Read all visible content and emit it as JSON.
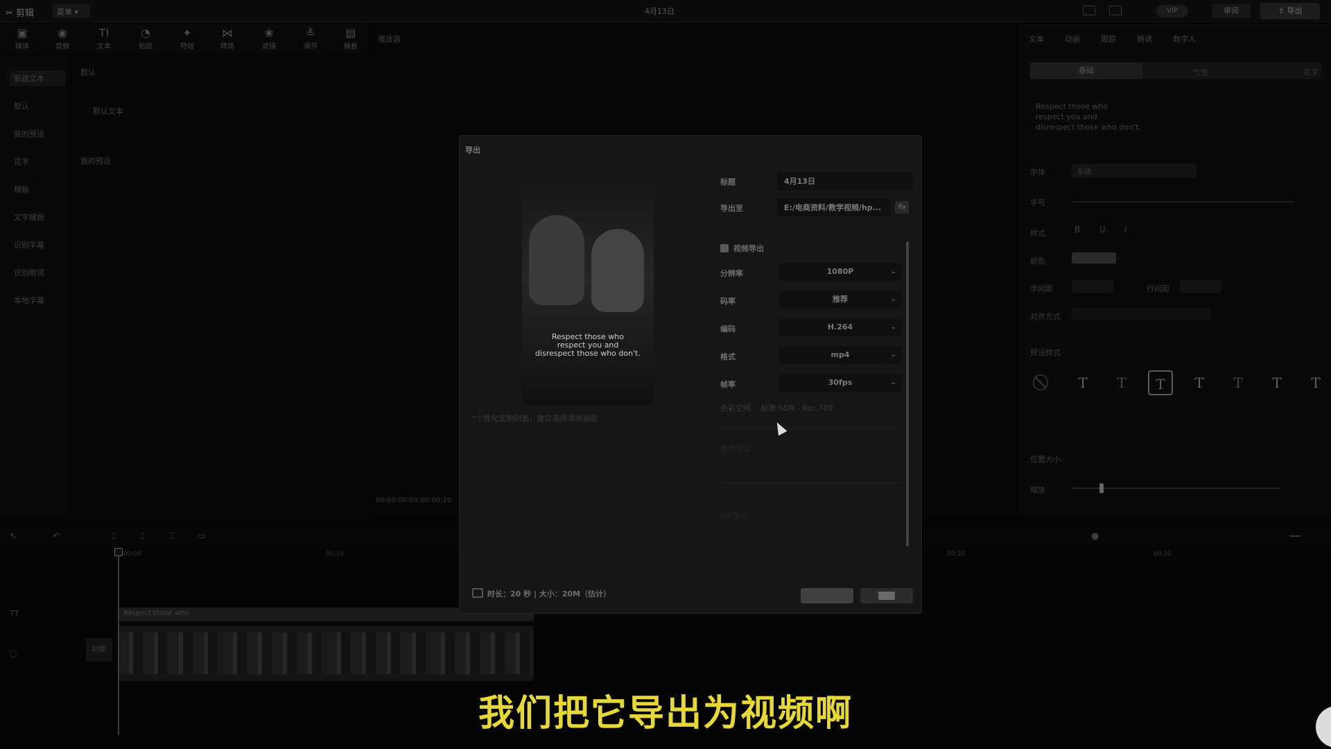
{
  "app": {
    "name": "剪辑",
    "menu": "菜单",
    "project_title": "4月13日"
  },
  "topbar": {
    "vip": "VIP",
    "review": "审阅",
    "export": "导出"
  },
  "toolbar": [
    "媒体",
    "音频",
    "文本",
    "贴纸",
    "特效",
    "转场",
    "滤镜",
    "调节",
    "模板"
  ],
  "player": {
    "title": "播放器",
    "time": "00:00:00:00  00:00:20"
  },
  "library": {
    "items": [
      "新建文本",
      "默认",
      "我的预设",
      "花字",
      "模板",
      "文字模板",
      "识别字幕",
      "识别歌词",
      "本地字幕"
    ],
    "content_header": "默认",
    "content_item": "默认文本",
    "content_section": "我的预设"
  },
  "inspector": {
    "tabs": [
      "文本",
      "动画",
      "跟踪",
      "朗读",
      "数字人"
    ],
    "subtabs": [
      "基础",
      "气泡",
      "花字"
    ],
    "preview_text": [
      "Respect those who",
      "respect you and",
      "disrespect those who don't."
    ],
    "labels": [
      "字体",
      "字号",
      "样式",
      "颜色",
      "字间距",
      "对齐方式",
      "预设样式",
      "位置大小",
      "缩放"
    ],
    "font_value": "系统",
    "spacing_label": "行间距",
    "preset_glyph": "T"
  },
  "timeline": {
    "ruler": [
      "00:00",
      "00:10",
      "00:20",
      "00:30"
    ],
    "text_clip": "Respect those who",
    "cover_label": "封面"
  },
  "export_dialog": {
    "title": "导出",
    "cover_caption": [
      "Respect those who",
      "respect you and",
      "disrespect those who don't."
    ],
    "cover_tip": "*个性化定制封面，建议选择清晰画面",
    "fields": {
      "title_label": "标题",
      "title_value": "4月13日",
      "path_label": "导出至",
      "path_value": "E:/电商资料/教学视频/hp...",
      "folder_icon_text": "Pa"
    },
    "video_export_label": "视频导出",
    "settings": [
      {
        "label": "分辨率",
        "value": "1080P"
      },
      {
        "label": "码率",
        "value": "推荐"
      },
      {
        "label": "编码",
        "value": "H.264"
      },
      {
        "label": "格式",
        "value": "mp4"
      },
      {
        "label": "帧率",
        "value": "30fps"
      }
    ],
    "color_space": "色彩空间：   标准 SDR - Rec.709",
    "ghost_rows": [
      "音频导出",
      "GIF导出"
    ],
    "footer_info": "时长：20 秒 | 大小：20M（估计）"
  },
  "subtitle": "我们把它导出为视频啊"
}
